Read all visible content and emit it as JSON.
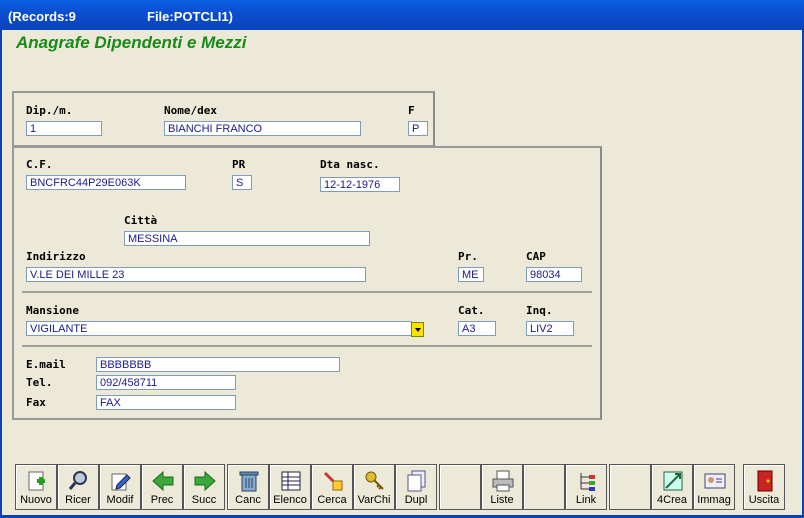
{
  "window": {
    "records": "(Records:9",
    "file": "File:POTCLI1)"
  },
  "app": {
    "title": "Anagrafe Dipendenti e Mezzi"
  },
  "form": {
    "dip_label": "Dip./m.",
    "dip_value": "1",
    "nome_label": "Nome/dex",
    "nome_value": "BIANCHI FRANCO",
    "f_label": "F",
    "f_value": "P",
    "cf_label": "C.F.",
    "cf_value": "BNCFRC44P29E063K",
    "pr1_label": "PR",
    "pr1_value": "S",
    "dta_label": "Dta nasc.",
    "dta_value": "12-12-1976",
    "citta_label": "Città",
    "citta_value": "MESSINA",
    "indirizzo_label": "Indirizzo",
    "indirizzo_value": "V.LE DEI MILLE 23",
    "pr2_label": "Pr.",
    "pr2_value": "ME",
    "cap_label": "CAP",
    "cap_value": "98034",
    "mansione_label": "Mansione",
    "mansione_value": "VIGILANTE",
    "cat_label": "Cat.",
    "cat_value": "A3",
    "inq_label": "Inq.",
    "inq_value": "LIV2",
    "email_label": "E.mail",
    "email_value": "BBBBBBB",
    "tel_label": "Tel.",
    "tel_value": "092/458711",
    "fax_label": "Fax",
    "fax_value": "FAX"
  },
  "toolbar": {
    "nuovo": "Nuovo",
    "ricer": "Ricer",
    "modif": "Modif",
    "prec": "Prec",
    "succ": "Succ",
    "canc": "Canc",
    "elenco": "Elenco",
    "cerca": "Cerca",
    "varchi": "VarChi",
    "dupl": "Dupl",
    "liste": "Liste",
    "link": "Link",
    "crea": "4Crea",
    "immag": "Immag",
    "uscita": "Uscita"
  },
  "colors": {
    "title_green": "#1a8a1a",
    "field_text": "#1a1a8a",
    "dropdown": "#f5e400",
    "titlebar": "#0b4fd0"
  }
}
